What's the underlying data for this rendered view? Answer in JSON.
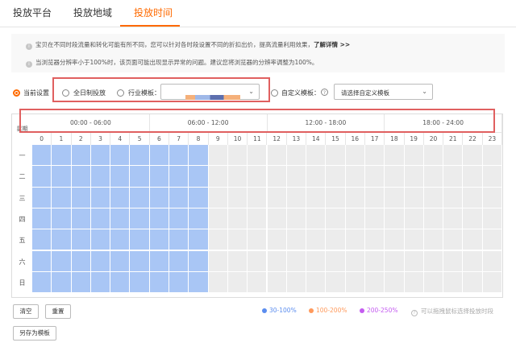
{
  "tabs": [
    {
      "label": "投放平台",
      "active": false
    },
    {
      "label": "投放地域",
      "active": false
    },
    {
      "label": "投放时间",
      "active": true
    }
  ],
  "notices": [
    {
      "text": "宝贝在不同时段流量和转化可能有所不同，您可以针对各时段设置不同的折扣出价，提高流量利用效果，",
      "link": "了解详情 >>"
    },
    {
      "text": "当浏览器分辨率小于100%时，该页面可能出现显示异常的问题。建议您将浏览器的分辨率调整为100%。",
      "link": ""
    }
  ],
  "settings": {
    "current_label": "当前设置",
    "full_day_label": "全日制投放",
    "industry_label": "行业模板：",
    "industry_value": "",
    "custom_label": "自定义模板：",
    "custom_placeholder": "请选择自定义模板",
    "help_symbol": "?"
  },
  "schedule": {
    "corner_label": "星期",
    "ranges": [
      "00:00 - 06:00",
      "06:00 - 12:00",
      "12:00 - 18:00",
      "18:00 - 24:00"
    ],
    "hours": [
      "0",
      "1",
      "2",
      "3",
      "4",
      "5",
      "6",
      "7",
      "8",
      "9",
      "10",
      "11",
      "12",
      "13",
      "14",
      "15",
      "16",
      "17",
      "18",
      "19",
      "20",
      "21",
      "22",
      "23"
    ],
    "days": [
      "一",
      "二",
      "三",
      "四",
      "五",
      "六",
      "日"
    ],
    "active_hours": [
      0,
      1,
      2,
      3,
      4,
      5,
      6,
      7,
      8
    ],
    "active_color": "#a9c6f5"
  },
  "actions": {
    "clear": "清空",
    "reset": "重置",
    "save_as": "另存为模板"
  },
  "legend": [
    {
      "label": "30-100%",
      "color": "#5b8def"
    },
    {
      "label": "100-200%",
      "color": "#ff9a5c"
    },
    {
      "label": "200-250%",
      "color": "#c45cf0"
    }
  ],
  "legend_hint": "可以拖拽鼠标选择投放时段",
  "colors": {
    "accent": "#ff6a00",
    "highlight_box": "#e06060"
  }
}
